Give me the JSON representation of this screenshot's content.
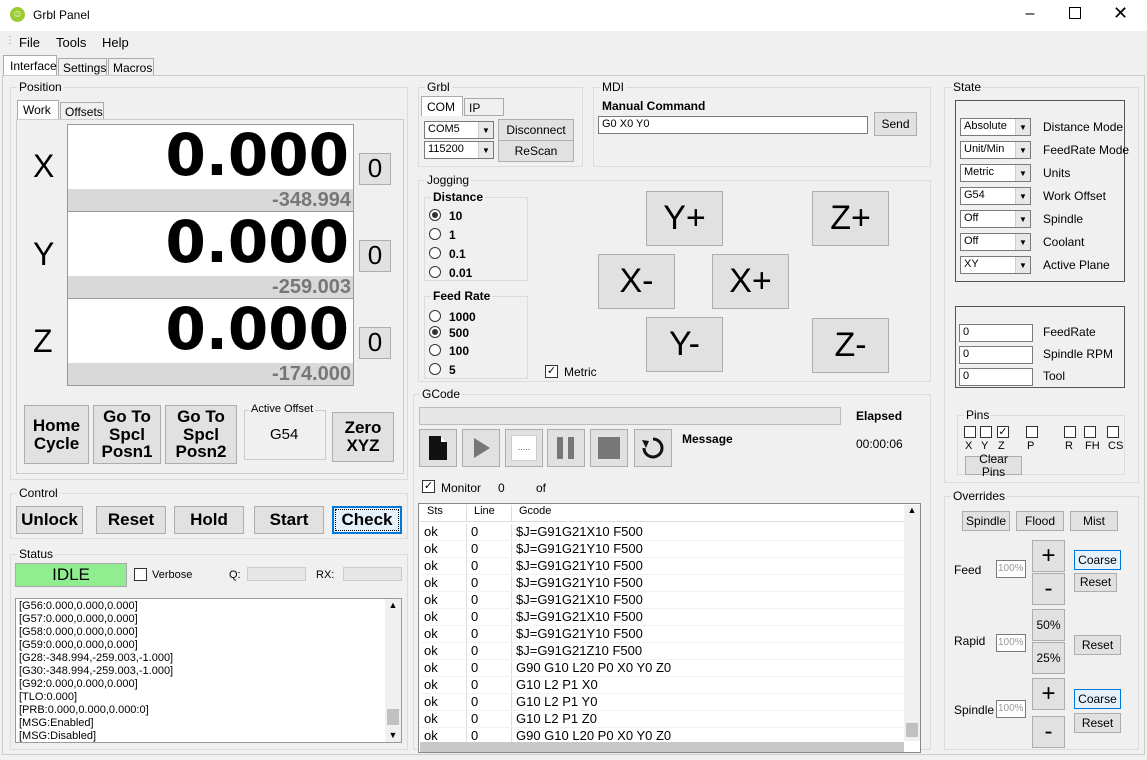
{
  "window": {
    "title": "Grbl Panel"
  },
  "menu": [
    "File",
    "Tools",
    "Help"
  ],
  "tabs": [
    "Interface",
    "Settings",
    "Macros"
  ],
  "position": {
    "label": "Position",
    "subtabs": [
      "Work",
      "Offsets"
    ],
    "axes": [
      {
        "axis": "X",
        "work": "0.000",
        "machine": "-348.994",
        "zero": "0"
      },
      {
        "axis": "Y",
        "work": "0.000",
        "machine": "-259.003",
        "zero": "0"
      },
      {
        "axis": "Z",
        "work": "0.000",
        "machine": "-174.000",
        "zero": "0"
      }
    ],
    "home_cycle": "Home Cycle",
    "goto1": "Go To Spcl Posn1",
    "goto2": "Go To Spcl Posn2",
    "active_offset_label": "Active Offset",
    "active_offset": "G54",
    "zero_xyz": "Zero XYZ"
  },
  "control": {
    "label": "Control",
    "buttons": [
      "Unlock",
      "Reset",
      "Hold",
      "Start",
      "Check"
    ]
  },
  "status": {
    "label": "Status",
    "state": "IDLE",
    "verbose": "Verbose",
    "q": "Q:",
    "rx": "RX:",
    "log": [
      "[G56:0.000,0.000,0.000]",
      "[G57:0.000,0.000,0.000]",
      "[G58:0.000,0.000,0.000]",
      "[G59:0.000,0.000,0.000]",
      "[G28:-348.994,-259.003,-1.000]",
      "[G30:-348.994,-259.003,-1.000]",
      "[G92:0.000,0.000,0.000]",
      "[TLO:0.000]",
      "[PRB:0.000,0.000,0.000:0]",
      "[MSG:Enabled]",
      "[MSG:Disabled]"
    ]
  },
  "grbl": {
    "label": "Grbl",
    "tabs": [
      "COM",
      "IP"
    ],
    "port": "COM5",
    "baud": "115200",
    "disconnect": "Disconnect",
    "rescan": "ReScan"
  },
  "mdi": {
    "label": "MDI",
    "title": "Manual Command",
    "value": "G0 X0 Y0",
    "send": "Send"
  },
  "jogging": {
    "label": "Jogging",
    "distance_label": "Distance",
    "distances": [
      "10",
      "1",
      "0.1",
      "0.01"
    ],
    "feed_label": "Feed Rate",
    "feeds": [
      "1000",
      "500",
      "100",
      "5"
    ],
    "metric": "Metric",
    "yplus": "Y+",
    "yminus": "Y-",
    "xplus": "X+",
    "xminus": "X-",
    "zplus": "Z+",
    "zminus": "Z-"
  },
  "gcode": {
    "label": "GCode",
    "elapsed_label": "Elapsed",
    "elapsed": "00:00:06",
    "message_label": "Message",
    "monitor": "Monitor",
    "count": "0",
    "of": "of",
    "columns": [
      "Sts",
      "Line",
      "Gcode"
    ],
    "rows": [
      [
        "ok",
        "0",
        "$J=G91G21X10 F500"
      ],
      [
        "ok",
        "0",
        "$J=G91G21Y10 F500"
      ],
      [
        "ok",
        "0",
        "$J=G91G21Y10 F500"
      ],
      [
        "ok",
        "0",
        "$J=G91G21Y10 F500"
      ],
      [
        "ok",
        "0",
        "$J=G91G21X10 F500"
      ],
      [
        "ok",
        "0",
        "$J=G91G21X10 F500"
      ],
      [
        "ok",
        "0",
        "$J=G91G21Y10 F500"
      ],
      [
        "ok",
        "0",
        "$J=G91G21Z10 F500"
      ],
      [
        "ok",
        "0",
        "G90 G10 L20 P0 X0 Y0 Z0"
      ],
      [
        "ok",
        "0",
        "G10 L2 P1 X0"
      ],
      [
        "ok",
        "0",
        "G10 L2 P1 Y0"
      ],
      [
        "ok",
        "0",
        "G10 L2 P1 Z0"
      ],
      [
        "ok",
        "0",
        "G90 G10 L20 P0 X0 Y0 Z0"
      ]
    ]
  },
  "state": {
    "label": "State",
    "modes": [
      [
        "Absolute",
        "Distance Mode"
      ],
      [
        "Unit/Min",
        "FeedRate Mode"
      ],
      [
        "Metric",
        "Units"
      ],
      [
        "G54",
        "Work Offset"
      ],
      [
        "Off",
        "Spindle"
      ],
      [
        "Off",
        "Coolant"
      ],
      [
        "XY",
        "Active Plane"
      ]
    ],
    "values": [
      [
        "0",
        "FeedRate"
      ],
      [
        "0",
        "Spindle RPM"
      ],
      [
        "0",
        "Tool"
      ]
    ]
  },
  "pins": {
    "label": "Pins",
    "names": [
      "X",
      "Y",
      "Z",
      "P",
      "R",
      "FH",
      "CS"
    ],
    "clear": "Clear Pins"
  },
  "overrides": {
    "label": "Overrides",
    "spindle": "Spindle",
    "flood": "Flood",
    "mist": "Mist",
    "feed": "Feed",
    "rapid": "Rapid",
    "spindle_row": "Spindle",
    "pct": "100%",
    "plus": "+",
    "minus": "-",
    "p50": "50%",
    "p25": "25%",
    "coarse": "Coarse",
    "reset": "Reset"
  }
}
